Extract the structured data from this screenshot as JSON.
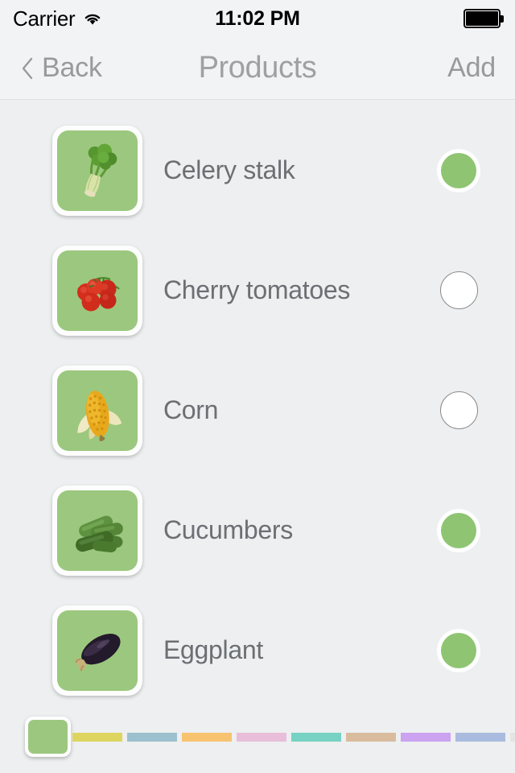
{
  "status_bar": {
    "carrier": "Carrier",
    "wifi_icon": "wifi-icon",
    "time": "11:02 PM",
    "battery_icon": "battery-full-icon"
  },
  "nav_bar": {
    "back_icon": "chevron-left-icon",
    "back_label": "Back",
    "title": "Products",
    "add_label": "Add"
  },
  "colors": {
    "accent_green": "#8FC572",
    "tile_green": "#9BC87E",
    "text_gray": "#6C6F73",
    "nav_gray": "#9A9A9A",
    "background": "#EDEFF0"
  },
  "list": {
    "items": [
      {
        "label": "Celery stalk",
        "image": "celery-image",
        "selected": true,
        "toggle_state": "on"
      },
      {
        "label": "Cherry tomatoes",
        "image": "tomatoes-image",
        "selected": false,
        "toggle_state": "off"
      },
      {
        "label": "Corn",
        "image": "corn-image",
        "selected": false,
        "toggle_state": "off"
      },
      {
        "label": "Cucumbers",
        "image": "cucumbers-image",
        "selected": true,
        "toggle_state": "on"
      },
      {
        "label": "Eggplant",
        "image": "eggplant-image",
        "selected": true,
        "toggle_state": "on"
      }
    ]
  },
  "color_picker": {
    "selected_color": "#9BC87E",
    "swatches": [
      {
        "name": "yellow",
        "hex": "#DED561"
      },
      {
        "name": "blue",
        "hex": "#9CC0CE"
      },
      {
        "name": "orange",
        "hex": "#F7C370"
      },
      {
        "name": "pink",
        "hex": "#E8BEDA"
      },
      {
        "name": "teal",
        "hex": "#77D2C4"
      },
      {
        "name": "tan",
        "hex": "#D9BC9E"
      },
      {
        "name": "purple",
        "hex": "#CBA3F0"
      },
      {
        "name": "periwinkle",
        "hex": "#A9BCDF"
      },
      {
        "name": "gray",
        "hex": "#E4E4E4"
      }
    ]
  }
}
